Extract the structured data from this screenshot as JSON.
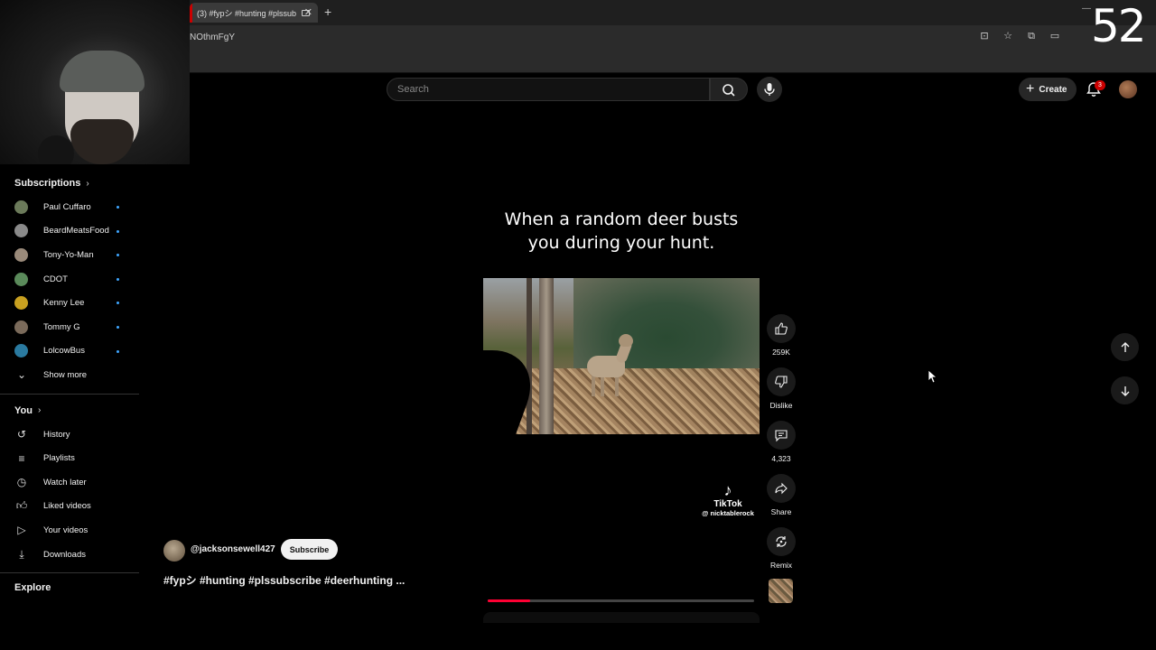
{
  "browser": {
    "tab_title": "(3) #fypシ #hunting #plssub",
    "url_fragment": "NOthmFgY",
    "overlay_number": "52"
  },
  "topbar": {
    "search_placeholder": "Search",
    "create_label": "Create",
    "notification_count": "3"
  },
  "sidebar": {
    "subscriptions_label": "Subscriptions",
    "channels": [
      {
        "name": "Paul Cuffaro",
        "color": "#6b7a5a"
      },
      {
        "name": "BeardMeatsFood",
        "color": "#8a8a8a"
      },
      {
        "name": "Tony-Yo-Man",
        "color": "#9a8a7a"
      },
      {
        "name": "CDOT",
        "color": "#5a8a5a"
      },
      {
        "name": "Kenny Lee",
        "color": "#c8a020"
      },
      {
        "name": "Tommy G",
        "color": "#7a6a5a"
      },
      {
        "name": "LolcowBus",
        "color": "#2a7aa0"
      }
    ],
    "show_more_label": "Show more",
    "you_label": "You",
    "you_items": [
      {
        "label": "History",
        "icon": "history-icon"
      },
      {
        "label": "Playlists",
        "icon": "playlists-icon"
      },
      {
        "label": "Watch later",
        "icon": "clock-icon"
      },
      {
        "label": "Liked videos",
        "icon": "thumbs-up-icon"
      },
      {
        "label": "Your videos",
        "icon": "play-icon"
      },
      {
        "label": "Downloads",
        "icon": "download-icon"
      }
    ],
    "explore_label": "Explore"
  },
  "video": {
    "caption": "When a random deer busts you during your hunt.",
    "watermark_name": "TikTok",
    "watermark_handle": "@ nicktablerock",
    "progress": 0.16
  },
  "actions": {
    "like_count": "259K",
    "dislike_label": "Dislike",
    "comment_count": "4,323",
    "share_label": "Share",
    "remix_label": "Remix"
  },
  "channel": {
    "handle": "@jacksonsewell427",
    "subscribe_label": "Subscribe",
    "hashtags": "#fypシ #hunting #plssubscribe #deerhunting ..."
  },
  "colors": {
    "accent_red": "#ff0033",
    "background": "#000000",
    "new_dot": "#3ea6ff"
  }
}
